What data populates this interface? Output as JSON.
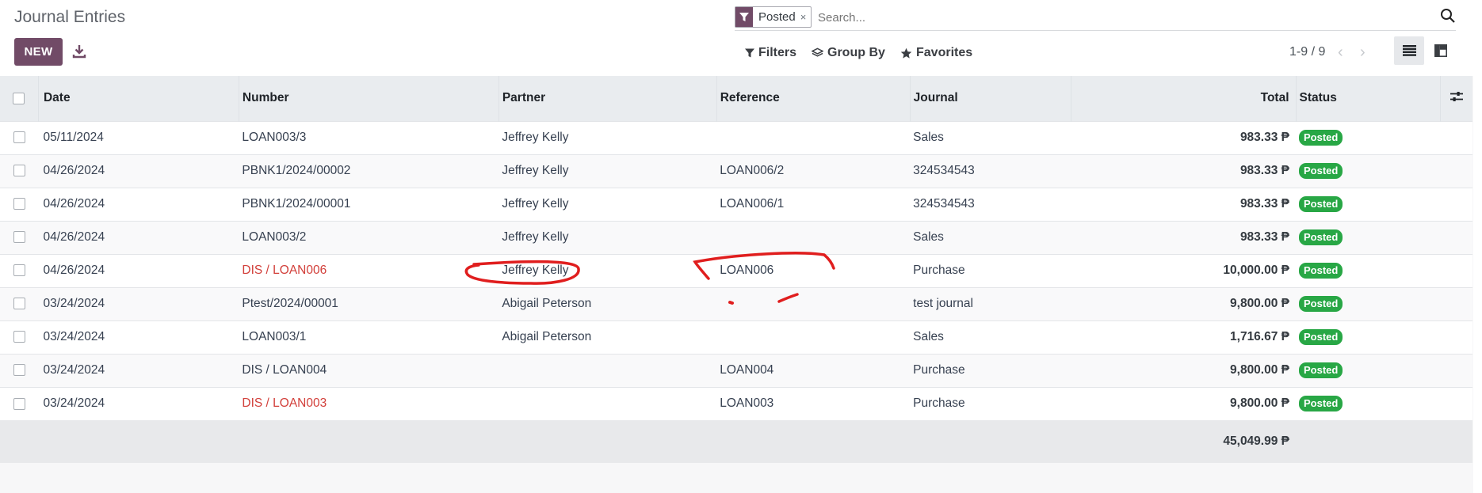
{
  "page": {
    "title": "Journal Entries",
    "new_label": "NEW"
  },
  "search": {
    "facet_label": "Posted",
    "facet_close": "×",
    "placeholder": "Search..."
  },
  "controls": {
    "filters_label": "Filters",
    "groupby_label": "Group By",
    "favorites_label": "Favorites",
    "pager": "1-9 / 9"
  },
  "table": {
    "columns": {
      "date": "Date",
      "number": "Number",
      "partner": "Partner",
      "reference": "Reference",
      "journal": "Journal",
      "total": "Total",
      "status": "Status"
    },
    "rows": [
      {
        "date": "05/11/2024",
        "number": "LOAN003/3",
        "partner": "Jeffrey Kelly",
        "reference": "",
        "journal": "Sales",
        "total": "983.33 ₱",
        "status": "Posted",
        "number_danger": false
      },
      {
        "date": "04/26/2024",
        "number": "PBNK1/2024/00002",
        "partner": "Jeffrey Kelly",
        "reference": "LOAN006/2",
        "journal": "324534543",
        "total": "983.33 ₱",
        "status": "Posted",
        "number_danger": false
      },
      {
        "date": "04/26/2024",
        "number": "PBNK1/2024/00001",
        "partner": "Jeffrey Kelly",
        "reference": "LOAN006/1",
        "journal": "324534543",
        "total": "983.33 ₱",
        "status": "Posted",
        "number_danger": false
      },
      {
        "date": "04/26/2024",
        "number": "LOAN003/2",
        "partner": "Jeffrey Kelly",
        "reference": "",
        "journal": "Sales",
        "total": "983.33 ₱",
        "status": "Posted",
        "number_danger": false
      },
      {
        "date": "04/26/2024",
        "number": "DIS / LOAN006",
        "partner": "Jeffrey Kelly",
        "reference": "LOAN006",
        "journal": "Purchase",
        "total": "10,000.00 ₱",
        "status": "Posted",
        "number_danger": true
      },
      {
        "date": "03/24/2024",
        "number": "Ptest/2024/00001",
        "partner": "Abigail Peterson",
        "reference": "",
        "journal": "test journal",
        "total": "9,800.00 ₱",
        "status": "Posted",
        "number_danger": false
      },
      {
        "date": "03/24/2024",
        "number": "LOAN003/1",
        "partner": "Abigail Peterson",
        "reference": "",
        "journal": "Sales",
        "total": "1,716.67 ₱",
        "status": "Posted",
        "number_danger": false
      },
      {
        "date": "03/24/2024",
        "number": "DIS / LOAN004",
        "partner": "",
        "reference": "LOAN004",
        "journal": "Purchase",
        "total": "9,800.00 ₱",
        "status": "Posted",
        "number_danger": false
      },
      {
        "date": "03/24/2024",
        "number": "DIS / LOAN003",
        "partner": "",
        "reference": "LOAN003",
        "journal": "Purchase",
        "total": "9,800.00 ₱",
        "status": "Posted",
        "number_danger": true
      }
    ],
    "grand_total": "45,049.99 ₱"
  },
  "colors": {
    "brand": "#714b67",
    "status_posted": "#28a745",
    "danger_text": "#d23f3a",
    "annotation": "#e01e1e"
  },
  "icons": {
    "download": "download-icon",
    "search": "search-icon",
    "filter": "filter-icon",
    "group_by": "layers-icon",
    "favorites": "star-icon",
    "list_view": "list-view-icon",
    "kanban_view": "kanban-view-icon",
    "optional_columns": "sliders-icon"
  }
}
